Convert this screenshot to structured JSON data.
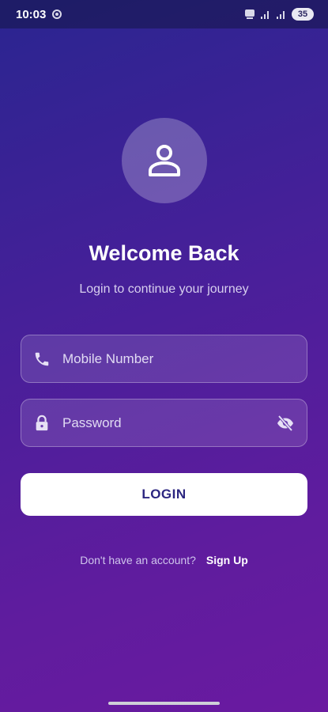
{
  "status_bar": {
    "time": "10:03",
    "battery": "35"
  },
  "header": {
    "title": "Welcome Back",
    "subtitle": "Login to continue your journey"
  },
  "form": {
    "mobile_placeholder": "Mobile Number",
    "password_placeholder": "Password",
    "login_label": "LOGIN"
  },
  "signup": {
    "prompt": "Don't have an account?",
    "link": "Sign Up"
  },
  "icons": {
    "avatar": "person-icon",
    "mobile": "phone-icon",
    "password": "lock-icon",
    "visibility": "eye-off-icon"
  },
  "colors": {
    "background_start": "#2a2590",
    "background_end": "#6a1aa0",
    "button_bg": "#ffffff",
    "button_text": "#2c2680"
  }
}
